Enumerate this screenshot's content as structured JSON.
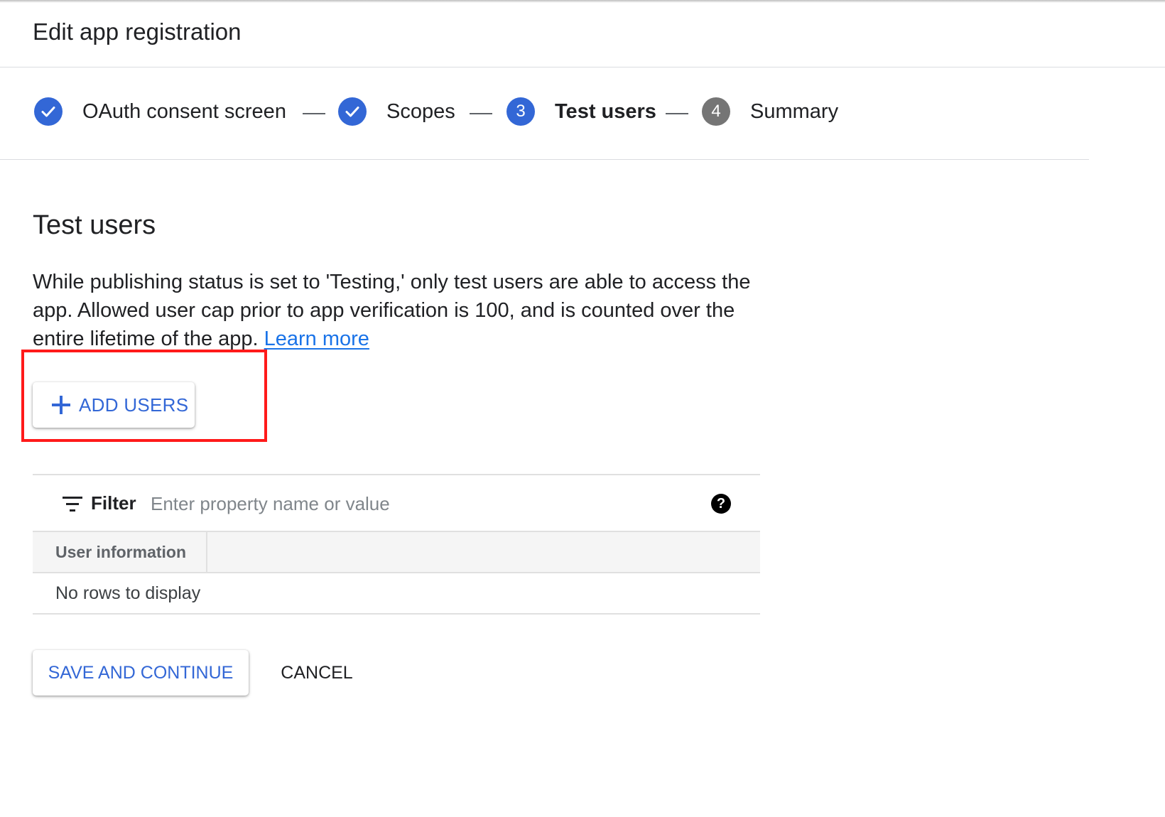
{
  "header": {
    "title": "Edit app registration"
  },
  "stepper": {
    "steps": [
      {
        "label": "OAuth consent screen",
        "state": "done",
        "marker": ""
      },
      {
        "label": "Scopes",
        "state": "done",
        "marker": ""
      },
      {
        "label": "Test users",
        "state": "active",
        "marker": "3"
      },
      {
        "label": "Summary",
        "state": "pending",
        "marker": "4"
      }
    ]
  },
  "section": {
    "title": "Test users",
    "description": "While publishing status is set to 'Testing,' only test users are able to access the app. Allowed user cap prior to app verification is 100, and is counted over the entire lifetime of the app.",
    "learn_more": "Learn more"
  },
  "add_users": {
    "label": "ADD USERS",
    "icon": "plus-icon"
  },
  "filter": {
    "label": "Filter",
    "placeholder": "Enter property name or value",
    "value": "",
    "help_icon": "?"
  },
  "table": {
    "columns": [
      "User information"
    ],
    "empty_message": "No rows to display"
  },
  "actions": {
    "save_label": "SAVE AND CONTINUE",
    "cancel_label": "CANCEL"
  },
  "colors": {
    "accent": "#3367d6",
    "link": "#1a73e8",
    "pending_step": "#757575",
    "highlight": "#ff1a1a"
  }
}
